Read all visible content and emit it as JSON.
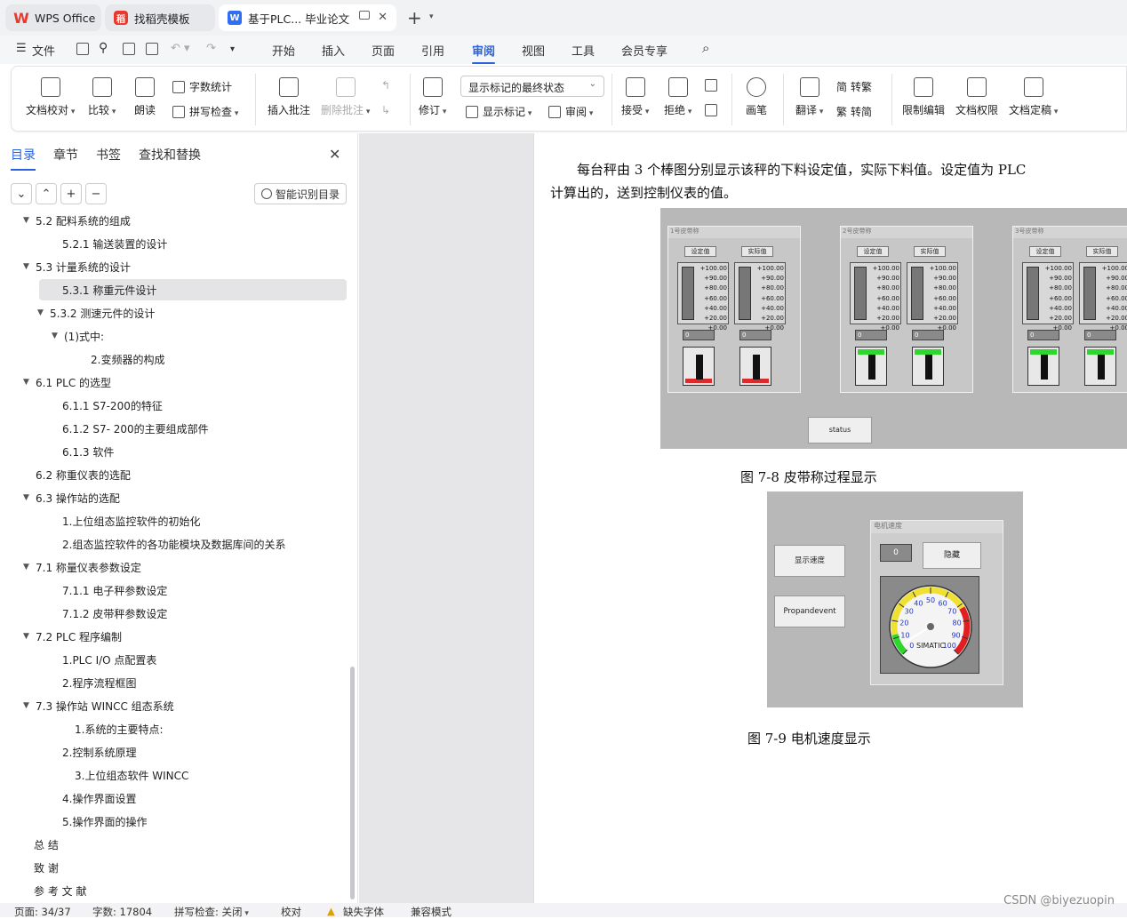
{
  "tabs": [
    {
      "label": "WPS Office",
      "icon": "wps-logo-icon"
    },
    {
      "label": "找稻壳模板",
      "icon": "docer-icon"
    },
    {
      "label": "基于PLC... 毕业论文",
      "icon": "writer-icon"
    }
  ],
  "menubar": {
    "file": "文件",
    "items": [
      "开始",
      "插入",
      "页面",
      "引用",
      "审阅",
      "视图",
      "工具",
      "会员专享"
    ],
    "active": "审阅"
  },
  "ribbon": {
    "doc_check": "文档校对",
    "compare": "比较",
    "read": "朗读",
    "word_count": "字数统计",
    "spell_check": "拼写检查",
    "insert_comment": "插入批注",
    "delete_comment": "删除批注",
    "revise": "修订",
    "mark_state": "显示标记的最终状态",
    "show_marks": "显示标记",
    "review": "审阅",
    "accept": "接受",
    "reject": "拒绝",
    "pen": "画笔",
    "translate": "翻译",
    "to_traditional": "转繁",
    "to_simplified": "转简",
    "restrict_edit": "限制编辑",
    "doc_permission": "文档权限",
    "finalize": "文档定稿"
  },
  "panel": {
    "tabs": [
      "目录",
      "章节",
      "书签",
      "查找和替换"
    ],
    "smart_toc": "智能识别目录",
    "toc": [
      {
        "text": "5.2  配料系统的组成",
        "level": 1,
        "arrow": true
      },
      {
        "text": "5.2.1  输送装置的设计",
        "level": 2,
        "arrow": false
      },
      {
        "text": "5.3  计量系统的设计",
        "level": 1,
        "arrow": true
      },
      {
        "text": "5.3.1  称重元件设计",
        "level": 2,
        "arrow": false,
        "selected": true
      },
      {
        "text": "5.3.2  测速元件的设计",
        "level": 2,
        "arrow": true
      },
      {
        "text": "(1)式中:",
        "level": 3,
        "arrow": true
      },
      {
        "text": "2.变频器的构成",
        "level": 4,
        "arrow": false
      },
      {
        "text": "6.1 PLC 的选型",
        "level": 1,
        "arrow": true
      },
      {
        "text": "6.1.1 S7-200的特征",
        "level": 2,
        "arrow": false
      },
      {
        "text": "6.1.2 S7- 200的主要组成部件",
        "level": 2,
        "arrow": false
      },
      {
        "text": "6.1.3  软件",
        "level": 2,
        "arrow": false
      },
      {
        "text": "6.2  称重仪表的选配",
        "level": 1,
        "arrow": false
      },
      {
        "text": "6.3   操作站的选配",
        "level": 1,
        "arrow": true
      },
      {
        "text": "1.上位组态监控软件的初始化",
        "level": 2,
        "arrow": false
      },
      {
        "text": "2.组态监控软件的各功能模块及数据库间的关系",
        "level": 2,
        "arrow": false
      },
      {
        "text": "7.1  称量仪表参数设定",
        "level": 1,
        "arrow": true
      },
      {
        "text": "7.1.1  电子秤参数设定",
        "level": 2,
        "arrow": false
      },
      {
        "text": "7.1.2  皮带秤参数设定",
        "level": 2,
        "arrow": false
      },
      {
        "text": "7.2 PLC 程序编制",
        "level": 1,
        "arrow": true
      },
      {
        "text": "1.PLC I/O 点配置表",
        "level": 2,
        "arrow": false
      },
      {
        "text": "2.程序流程框图",
        "level": 2,
        "arrow": false
      },
      {
        "text": "7.3 操作站 WINCC 组态系统",
        "level": 1,
        "arrow": true
      },
      {
        "text": "1.系统的主要特点:",
        "level": 3,
        "arrow": false
      },
      {
        "text": "2.控制系统原理",
        "level": 2,
        "arrow": false
      },
      {
        "text": "3.上位组态软件 WINCC",
        "level": 3,
        "arrow": false
      },
      {
        "text": "4.操作界面设置",
        "level": 2,
        "arrow": false
      },
      {
        "text": "5.操作界面的操作",
        "level": 2,
        "arrow": false
      },
      {
        "text": "总    结",
        "level": 0,
        "arrow": false
      },
      {
        "text": "致  谢",
        "level": 0,
        "arrow": false
      },
      {
        "text": "参 考 文 献",
        "level": 0,
        "arrow": false
      }
    ]
  },
  "document": {
    "para1_line1": "每台秤由 3 个棒图分别显示该秤的下料设定值，实际下料值。设定值为 PLC",
    "para1_line2": "计算出的，送到控制仪表的值。",
    "fig1": {
      "windows": [
        "1号皮带称",
        "2号皮带称",
        "3号皮带称"
      ],
      "header_set": "设定值",
      "header_actual": "实际值",
      "scale": [
        "+100.00",
        "+90.00",
        "+80.00",
        "+60.00",
        "+40.00",
        "+20.00",
        "+0.00"
      ],
      "value": "0",
      "status_button": "status"
    },
    "caption1": "图 7-8  皮带称过程显示",
    "fig2": {
      "btn_show_speed": "显示速度",
      "btn_propandevent": "Propandevent",
      "window_title": "电机速度",
      "value": "0",
      "hide_button": "隐藏",
      "gauge_labels": [
        "0",
        "10",
        "20",
        "30",
        "40",
        "50",
        "60",
        "70",
        "80",
        "90",
        "100"
      ],
      "gauge_brand": "SIMATIC",
      "gauge_needle_value": 5
    },
    "caption2": "图 7-9  电机速度显示"
  },
  "statusbar": {
    "page": "页面: 34/37",
    "words": "字数: 17804",
    "spell": "拼写检查: 关闭",
    "proof": "校对",
    "missing_font": "缺失字体",
    "compat": "兼容模式"
  },
  "watermark": "CSDN @biyezuopin",
  "colors": {
    "accent": "#2a63e0",
    "wps_red": "#e8392c"
  }
}
